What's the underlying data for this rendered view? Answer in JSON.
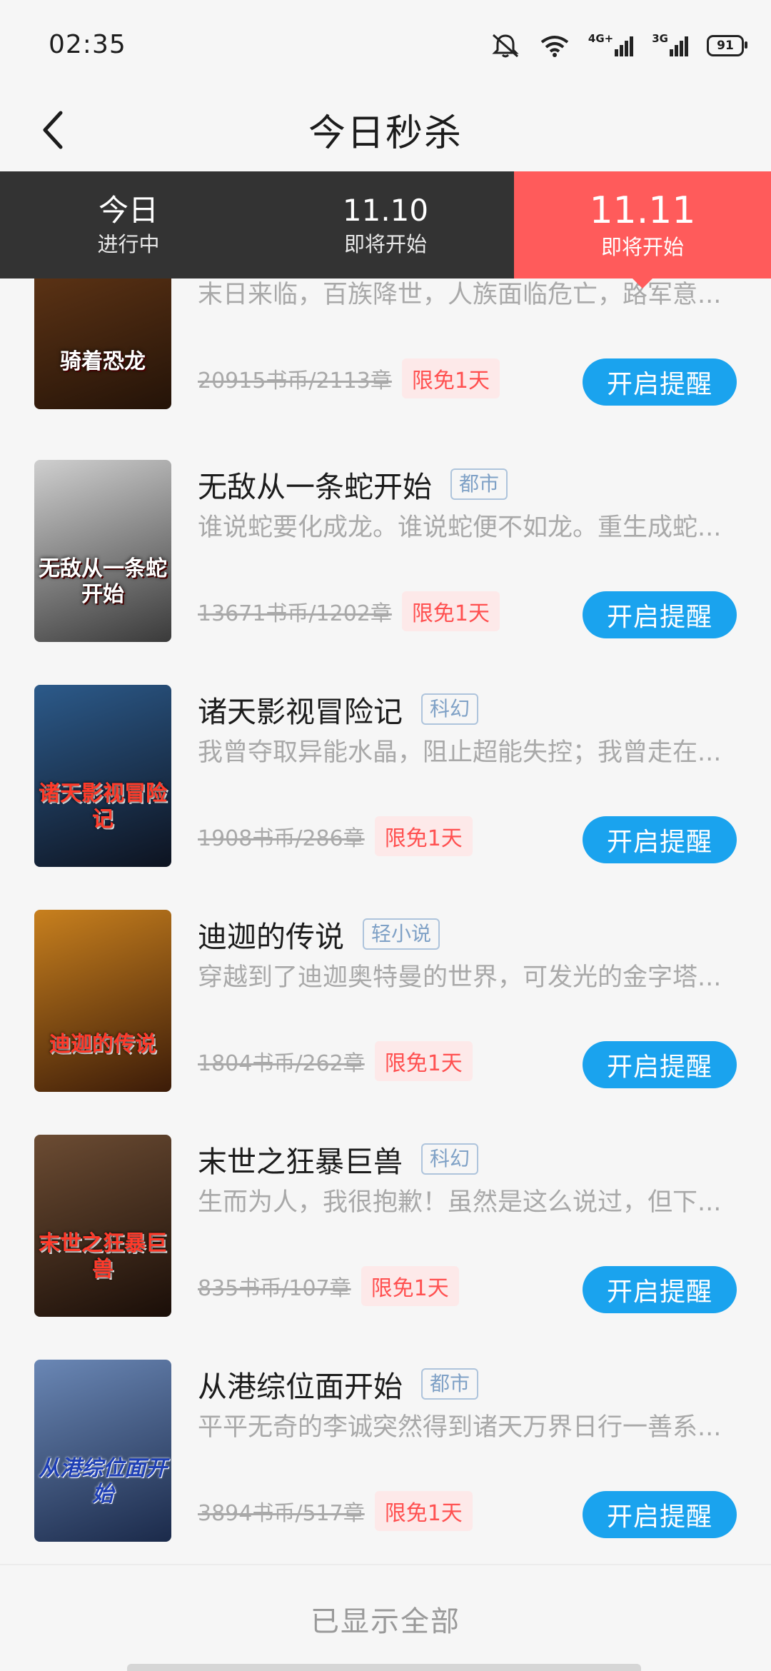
{
  "status_bar": {
    "time": "02:35",
    "network_4g": "4G+",
    "network_3g": "3G",
    "battery": "91"
  },
  "header": {
    "title": "今日秒杀"
  },
  "tabs": [
    {
      "label": "今日",
      "sub": "进行中",
      "active": false
    },
    {
      "label": "11.10",
      "sub": "即将开始",
      "active": false
    },
    {
      "label": "11.11",
      "sub": "即将开始",
      "active": true
    }
  ],
  "books": [
    {
      "title": "",
      "tag": "",
      "desc": "末日来临，百族降世，人族面临危亡，路军意...",
      "orig_price": "20915书币/2113章",
      "free": "限免1天",
      "button": "开启提醒",
      "cover_title": "骑着恐龙",
      "cover_colors": [
        "#6a3b18",
        "#241308"
      ]
    },
    {
      "title": "无敌从一条蛇开始",
      "tag": "都市",
      "desc": "谁说蛇要化成龙。谁说蛇便不如龙。重生成蛇...",
      "orig_price": "13671书币/1202章",
      "free": "限免1天",
      "button": "开启提醒",
      "cover_title": "无敌从一条蛇开始",
      "cover_colors": [
        "#cfcfcf",
        "#3a3a3a"
      ]
    },
    {
      "title": "诸天影视冒险记",
      "tag": "科幻",
      "desc": "我曾夺取异能水晶，阻止超能失控；我曾走在...",
      "orig_price": "1908书币/286章",
      "free": "限免1天",
      "button": "开启提醒",
      "cover_title": "诸天影视冒险记",
      "cover_colors": [
        "#2c5a8a",
        "#0d1320"
      ]
    },
    {
      "title": "迪迦的传说",
      "tag": "轻小说",
      "desc": "穿越到了迪迦奥特曼的世界，可发光的金字塔...",
      "orig_price": "1804书币/262章",
      "free": "限免1天",
      "button": "开启提醒",
      "cover_title": "迪迦的传说",
      "cover_colors": [
        "#c8801e",
        "#3b1b08"
      ]
    },
    {
      "title": "末世之狂暴巨兽",
      "tag": "科幻",
      "desc": "生而为人，我很抱歉！虽然是这么说过，但下...",
      "orig_price": "835书币/107章",
      "free": "限免1天",
      "button": "开启提醒",
      "cover_title": "末世之狂暴巨兽",
      "cover_colors": [
        "#6c4c33",
        "#1a0e08"
      ]
    },
    {
      "title": "从港综位面开始",
      "tag": "都市",
      "desc": "平平无奇的李诚突然得到诸天万界日行一善系...",
      "orig_price": "3894书币/517章",
      "free": "限免1天",
      "button": "开启提醒",
      "cover_title": "从港综位面开始",
      "cover_colors": [
        "#6a87b5",
        "#1b2a4a"
      ]
    }
  ],
  "footer": {
    "text": "已显示全部"
  },
  "colors": {
    "accent_red": "#ff5b5b",
    "button_blue": "#1aa3ee",
    "tab_dark": "#333333"
  }
}
